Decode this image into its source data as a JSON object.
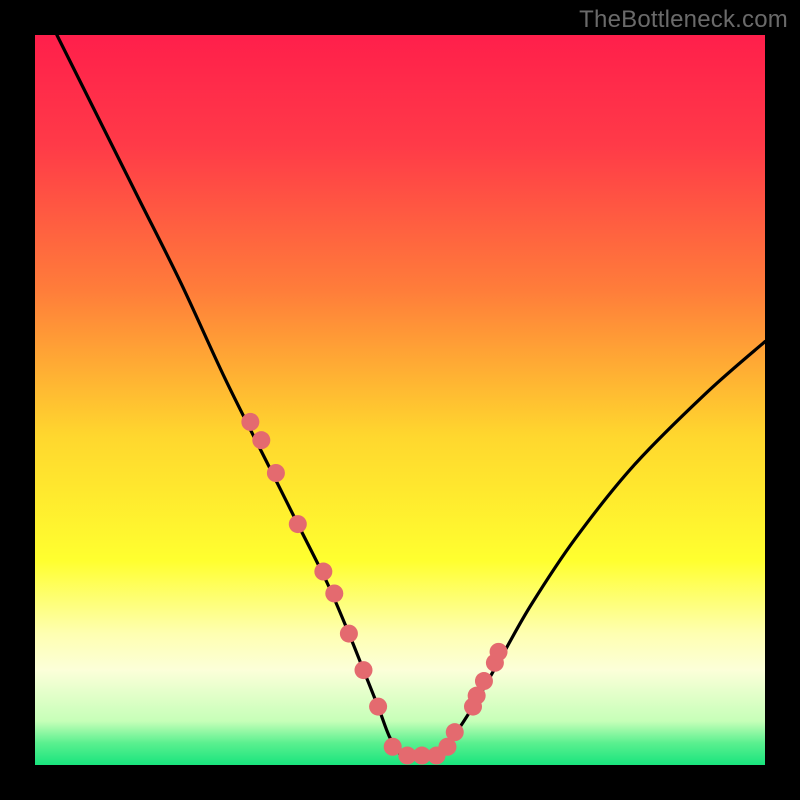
{
  "watermark": "TheBottleneck.com",
  "chart_data": {
    "type": "line",
    "title": "",
    "xlabel": "",
    "ylabel": "",
    "xlim": [
      0,
      100
    ],
    "ylim": [
      0,
      100
    ],
    "gradient_stops": [
      {
        "offset": 0,
        "color": "#ff1f4b"
      },
      {
        "offset": 15,
        "color": "#ff3a48"
      },
      {
        "offset": 35,
        "color": "#ff7d3a"
      },
      {
        "offset": 55,
        "color": "#ffd72e"
      },
      {
        "offset": 72,
        "color": "#ffff2f"
      },
      {
        "offset": 82,
        "color": "#feffb1"
      },
      {
        "offset": 87,
        "color": "#fcffd9"
      },
      {
        "offset": 94,
        "color": "#c6ffb8"
      },
      {
        "offset": 97,
        "color": "#5af08f"
      },
      {
        "offset": 100,
        "color": "#18e47d"
      }
    ],
    "series": [
      {
        "name": "curve",
        "x": [
          3,
          8,
          14,
          20,
          26,
          32,
          36,
          40,
          43,
          45,
          47,
          48.5,
          50,
          51,
          53,
          55,
          57,
          60,
          64,
          68,
          74,
          82,
          92,
          100
        ],
        "y": [
          100,
          90,
          78,
          66,
          53,
          41,
          33,
          25,
          18,
          13,
          8,
          4,
          1.5,
          1.2,
          1.2,
          1.5,
          3.5,
          8,
          15,
          22,
          31,
          41,
          51,
          58
        ]
      }
    ],
    "scatter": {
      "name": "dots",
      "x": [
        29.5,
        31,
        33,
        36,
        39.5,
        41,
        43,
        45,
        47,
        49,
        51,
        53,
        55,
        56.5,
        57.5,
        60,
        60.5,
        61.5,
        63,
        63.5
      ],
      "y": [
        47,
        44.5,
        40,
        33,
        26.5,
        23.5,
        18,
        13,
        8,
        2.5,
        1.3,
        1.3,
        1.3,
        2.5,
        4.5,
        8,
        9.5,
        11.5,
        14,
        15.5
      ]
    },
    "marker_color": "#e46a6f",
    "marker_radius": 9
  }
}
